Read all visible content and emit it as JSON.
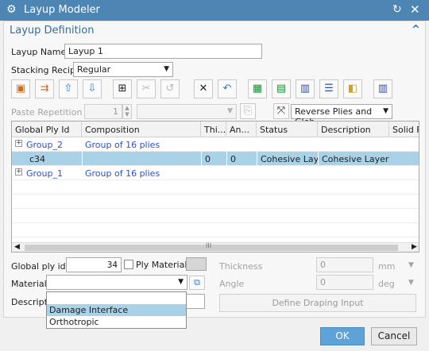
{
  "window": {
    "title": "Layup Modeler"
  },
  "section": {
    "title": "Layup Definition"
  },
  "layup_name": {
    "label": "Layup Name",
    "value": "Layup 1"
  },
  "stacking_recipe": {
    "label": "Stacking Recipe",
    "value": "Regular"
  },
  "paste_repetition": {
    "label": "Paste Repetition",
    "value": "1"
  },
  "reverse": {
    "value": "Reverse Plies and Glob"
  },
  "toolbar_icons": [
    "layup-icon",
    "merge-icon",
    "move-up-icon",
    "move-down-icon",
    "tree-icon",
    "split-icon",
    "refresh-icon",
    "delete-icon",
    "undo-icon",
    "excel-export-icon",
    "table-icon",
    "table-alt-icon",
    "list-icon",
    "ply-orientation-icon",
    "table-extra-icon"
  ],
  "grid": {
    "headers": [
      "Global Ply Id",
      "Composition",
      "Thi...",
      "An...",
      "Status",
      "Description",
      "Solid Pr"
    ],
    "rows": [
      {
        "id": "Group_2",
        "composition": "Group of 16 plies",
        "thickness": "",
        "angle": "",
        "status": "",
        "description": "",
        "expand": "+"
      },
      {
        "id": "c34",
        "composition": "",
        "thickness": "0",
        "angle": "0",
        "status": "Cohesive Layer",
        "description": "Cohesive Layer",
        "expand": ""
      },
      {
        "id": "Group_1",
        "composition": "Group of 16 plies",
        "thickness": "",
        "angle": "",
        "status": "",
        "description": "",
        "expand": "+"
      }
    ],
    "scroll_marker": "III"
  },
  "global_ply_id": {
    "label": "Global ply id",
    "value": "34"
  },
  "ply_material": {
    "label": "Ply Material"
  },
  "thickness": {
    "label": "Thickness",
    "value": "0",
    "unit": "mm"
  },
  "angle": {
    "label": "Angle",
    "value": "0",
    "unit": "deg"
  },
  "material": {
    "label": "Material",
    "value": ""
  },
  "description": {
    "label": "Descriptio"
  },
  "material_options": [
    "Damage Interface",
    "Orthotropic"
  ],
  "define_draping": {
    "label": "Define Draping Input"
  },
  "buttons": {
    "ok": "OK",
    "cancel": "Cancel"
  }
}
